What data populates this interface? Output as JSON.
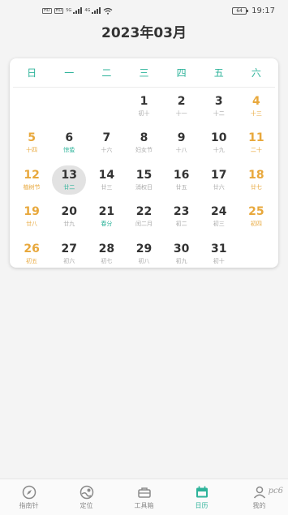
{
  "status_bar": {
    "sim1": "HD",
    "sim2": "HD",
    "net1": "5G",
    "net2": "4G",
    "battery": "64",
    "time": "19:17"
  },
  "header": {
    "title": "2023年03月"
  },
  "calendar": {
    "weekdays": [
      "日",
      "一",
      "二",
      "三",
      "四",
      "五",
      "六"
    ],
    "today": 13,
    "days": [
      {
        "num": "",
        "lunar": ""
      },
      {
        "num": "",
        "lunar": ""
      },
      {
        "num": "",
        "lunar": ""
      },
      {
        "num": "1",
        "lunar": "初十"
      },
      {
        "num": "2",
        "lunar": "十一"
      },
      {
        "num": "3",
        "lunar": "十二"
      },
      {
        "num": "4",
        "lunar": "十三"
      },
      {
        "num": "5",
        "lunar": "十四"
      },
      {
        "num": "6",
        "lunar": "惊蛰",
        "term": true
      },
      {
        "num": "7",
        "lunar": "十六"
      },
      {
        "num": "8",
        "lunar": "妇女节"
      },
      {
        "num": "9",
        "lunar": "十八"
      },
      {
        "num": "10",
        "lunar": "十九"
      },
      {
        "num": "11",
        "lunar": "二十"
      },
      {
        "num": "12",
        "lunar": "植树节"
      },
      {
        "num": "13",
        "lunar": "廿二"
      },
      {
        "num": "14",
        "lunar": "廿三"
      },
      {
        "num": "15",
        "lunar": "消权日"
      },
      {
        "num": "16",
        "lunar": "廿五"
      },
      {
        "num": "17",
        "lunar": "廿六"
      },
      {
        "num": "18",
        "lunar": "廿七"
      },
      {
        "num": "19",
        "lunar": "廿八"
      },
      {
        "num": "20",
        "lunar": "廿九"
      },
      {
        "num": "21",
        "lunar": "春分",
        "term": true
      },
      {
        "num": "22",
        "lunar": "闰二月"
      },
      {
        "num": "23",
        "lunar": "初二"
      },
      {
        "num": "24",
        "lunar": "初三"
      },
      {
        "num": "25",
        "lunar": "初四"
      },
      {
        "num": "26",
        "lunar": "初五"
      },
      {
        "num": "27",
        "lunar": "初六"
      },
      {
        "num": "28",
        "lunar": "初七"
      },
      {
        "num": "29",
        "lunar": "初八"
      },
      {
        "num": "30",
        "lunar": "初九"
      },
      {
        "num": "31",
        "lunar": "初十"
      },
      {
        "num": "",
        "lunar": ""
      }
    ]
  },
  "nav": {
    "items": [
      {
        "label": "指南针",
        "icon": "compass-icon"
      },
      {
        "label": "定位",
        "icon": "location-icon"
      },
      {
        "label": "工具箱",
        "icon": "toolbox-icon"
      },
      {
        "label": "日历",
        "icon": "calendar-icon",
        "active": true
      },
      {
        "label": "我的",
        "icon": "user-icon"
      }
    ]
  },
  "watermark": "pc6",
  "colors": {
    "accent": "#2db39a",
    "weekend": "#e8a83c",
    "lunar": "#aaaaaa"
  }
}
